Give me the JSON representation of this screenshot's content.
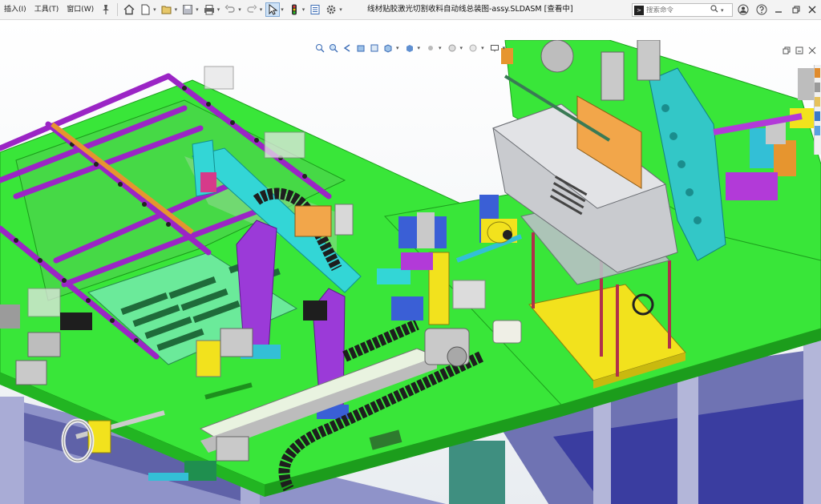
{
  "menu": {
    "items": [
      {
        "label": "插入(I)",
        "name": "menu-insert"
      },
      {
        "label": "工具(T)",
        "name": "menu-tools"
      },
      {
        "label": "窗口(W)",
        "name": "menu-window"
      }
    ]
  },
  "title": {
    "text": "线材贴胶激光切割收料自动线总装图-assy.SLDASM [查看中]"
  },
  "search": {
    "placeholder": "搜索命令",
    "icon": ">"
  },
  "toolbar": {
    "icons": [
      "pin-icon",
      "home-icon",
      "new-document-icon",
      "open-icon",
      "save-icon",
      "print-icon",
      "undo-icon",
      "redo-icon",
      "select-cursor-icon",
      "traffic-light-icon",
      "file-properties-icon",
      "options-gear-icon"
    ]
  },
  "colors": {
    "platform": "#39e639",
    "purple": "#b23ad8",
    "cyan": "#33d6d6",
    "blue": "#3a5fd6",
    "frame": "#8f93c9",
    "yellow": "#f2e21d",
    "orange": "#e6952f",
    "grey": "#c9c9c9",
    "magenta": "#c43cc4"
  }
}
